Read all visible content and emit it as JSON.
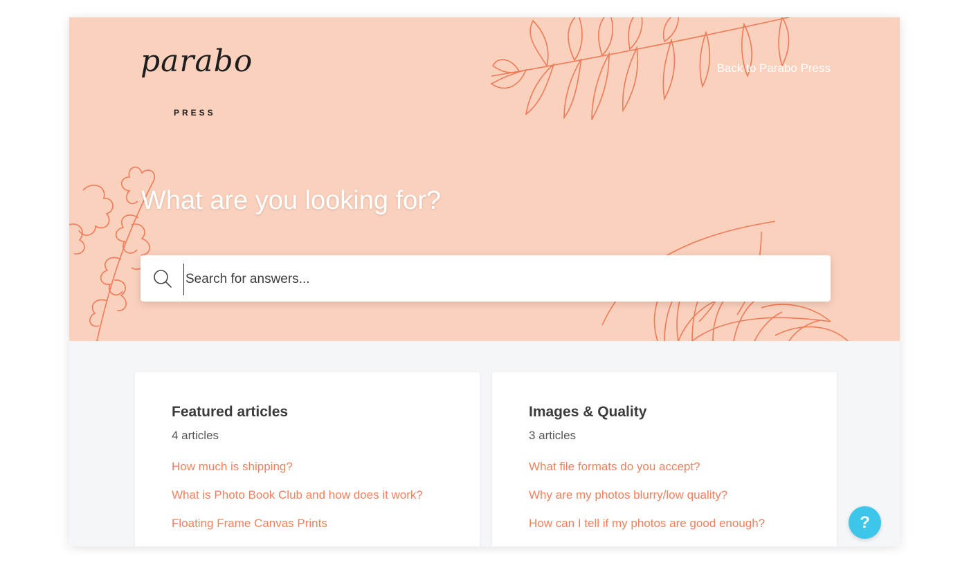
{
  "brand": {
    "logo_script": "parabo",
    "logo_sub": "PRESS",
    "accent": "#f1805d",
    "hero_bg": "#fad1bd",
    "help_color": "#3cc6ea"
  },
  "header": {
    "back_link": "Back to Parabo Press"
  },
  "hero": {
    "title": "What are you looking for?"
  },
  "search": {
    "placeholder": "Search for answers...",
    "icon": "search-icon"
  },
  "sections": [
    {
      "title": "Featured articles",
      "count": "4 articles",
      "articles": [
        "How much is shipping?",
        "What is Photo Book Club and how does it work?",
        "Floating Frame Canvas Prints"
      ]
    },
    {
      "title": "Images & Quality",
      "count": "3 articles",
      "articles": [
        "What file formats do you accept?",
        "Why are my photos blurry/low quality?",
        "How can I tell if my photos are good enough?"
      ]
    }
  ],
  "help": {
    "label": "?",
    "icon": "help-icon"
  }
}
